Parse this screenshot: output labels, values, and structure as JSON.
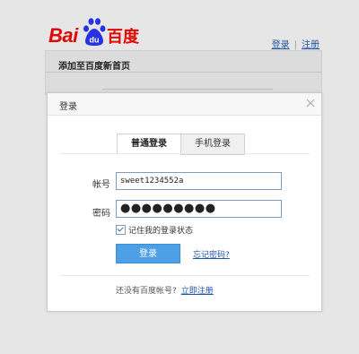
{
  "logo": {
    "latin": "Bai",
    "paw": "du",
    "chinese": "百度"
  },
  "top_links": {
    "login": "登录",
    "separator": "|",
    "register": "注册"
  },
  "background_panel": {
    "title": "添加至百度新首页"
  },
  "dialog": {
    "title": "登录",
    "tabs": [
      {
        "label": "普通登录",
        "active": true
      },
      {
        "label": "手机登录",
        "active": false
      }
    ],
    "account_label": "帐号",
    "account_value": "sweet1234552a",
    "password_label": "密码",
    "password_mask": "●●●●●●●●●",
    "remember_label": "记住我的登录状态",
    "remember_checked": true,
    "login_button": "登录",
    "forgot_link": "忘记密码?",
    "footer_text": "还没有百度帐号?",
    "register_link": "立即注册"
  },
  "colors": {
    "brand_red": "#e10602",
    "brand_blue": "#2932e1",
    "link": "#1f56a5",
    "button": "#4da0e6"
  },
  "icons": [
    "baidu-paw-icon",
    "close-icon",
    "checkbox-checked-icon"
  ]
}
